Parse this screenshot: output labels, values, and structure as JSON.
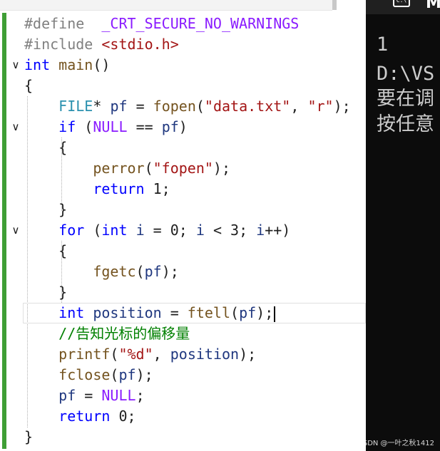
{
  "editor": {
    "lines": [
      {
        "fold": "",
        "tokens": [
          {
            "t": "#define  ",
            "c": "pp"
          },
          {
            "t": "_CRT_SECURE_NO_WARNINGS",
            "c": "mac"
          }
        ]
      },
      {
        "fold": "",
        "tokens": [
          {
            "t": "#include ",
            "c": "pp"
          },
          {
            "t": "<stdio.h>",
            "c": "str"
          }
        ]
      },
      {
        "fold": "∨",
        "tokens": [
          {
            "t": "int",
            "c": "kw"
          },
          {
            "t": " ",
            "c": "plain"
          },
          {
            "t": "main",
            "c": "fn"
          },
          {
            "t": "()",
            "c": "plain"
          }
        ]
      },
      {
        "fold": "",
        "tokens": [
          {
            "t": "{",
            "c": "plain"
          }
        ]
      },
      {
        "fold": "",
        "tokens": [
          {
            "t": "    ",
            "c": "plain"
          },
          {
            "t": "FILE",
            "c": "ty"
          },
          {
            "t": "* ",
            "c": "plain"
          },
          {
            "t": "pf",
            "c": "var"
          },
          {
            "t": " = ",
            "c": "plain"
          },
          {
            "t": "fopen",
            "c": "fn"
          },
          {
            "t": "(",
            "c": "plain"
          },
          {
            "t": "\"data.txt\"",
            "c": "str"
          },
          {
            "t": ", ",
            "c": "plain"
          },
          {
            "t": "\"r\"",
            "c": "str"
          },
          {
            "t": ");",
            "c": "plain"
          }
        ]
      },
      {
        "fold": "∨",
        "tokens": [
          {
            "t": "    ",
            "c": "plain"
          },
          {
            "t": "if",
            "c": "kw"
          },
          {
            "t": " (",
            "c": "plain"
          },
          {
            "t": "NULL",
            "c": "mac"
          },
          {
            "t": " == ",
            "c": "plain"
          },
          {
            "t": "pf",
            "c": "var"
          },
          {
            "t": ")",
            "c": "plain"
          }
        ]
      },
      {
        "fold": "",
        "tokens": [
          {
            "t": "    {",
            "c": "plain"
          }
        ]
      },
      {
        "fold": "",
        "tokens": [
          {
            "t": "        ",
            "c": "plain"
          },
          {
            "t": "perror",
            "c": "fn"
          },
          {
            "t": "(",
            "c": "plain"
          },
          {
            "t": "\"fopen\"",
            "c": "str"
          },
          {
            "t": ");",
            "c": "plain"
          }
        ]
      },
      {
        "fold": "",
        "tokens": [
          {
            "t": "        ",
            "c": "plain"
          },
          {
            "t": "return",
            "c": "kw"
          },
          {
            "t": " 1;",
            "c": "plain"
          }
        ]
      },
      {
        "fold": "",
        "tokens": [
          {
            "t": "    }",
            "c": "plain"
          }
        ]
      },
      {
        "fold": "∨",
        "tokens": [
          {
            "t": "    ",
            "c": "plain"
          },
          {
            "t": "for",
            "c": "kw"
          },
          {
            "t": " (",
            "c": "plain"
          },
          {
            "t": "int",
            "c": "kw"
          },
          {
            "t": " ",
            "c": "plain"
          },
          {
            "t": "i",
            "c": "var"
          },
          {
            "t": " = 0; ",
            "c": "plain"
          },
          {
            "t": "i",
            "c": "var"
          },
          {
            "t": " < 3; ",
            "c": "plain"
          },
          {
            "t": "i",
            "c": "var"
          },
          {
            "t": "++)",
            "c": "plain"
          }
        ]
      },
      {
        "fold": "",
        "tokens": [
          {
            "t": "    {",
            "c": "plain"
          }
        ]
      },
      {
        "fold": "",
        "tokens": [
          {
            "t": "        ",
            "c": "plain"
          },
          {
            "t": "fgetc",
            "c": "fn"
          },
          {
            "t": "(",
            "c": "plain"
          },
          {
            "t": "pf",
            "c": "var"
          },
          {
            "t": ");",
            "c": "plain"
          }
        ]
      },
      {
        "fold": "",
        "tokens": [
          {
            "t": "    }",
            "c": "plain"
          }
        ]
      },
      {
        "fold": "",
        "current": true,
        "tokens": [
          {
            "t": "    ",
            "c": "plain"
          },
          {
            "t": "int",
            "c": "kw"
          },
          {
            "t": " ",
            "c": "plain"
          },
          {
            "t": "position",
            "c": "var"
          },
          {
            "t": " = ",
            "c": "plain"
          },
          {
            "t": "ftell",
            "c": "fn"
          },
          {
            "t": "(",
            "c": "plain"
          },
          {
            "t": "pf",
            "c": "var"
          },
          {
            "t": ");",
            "c": "plain"
          }
        ]
      },
      {
        "fold": "",
        "tokens": [
          {
            "t": "    ",
            "c": "plain"
          },
          {
            "t": "//告知光标的偏移量",
            "c": "cmt"
          }
        ]
      },
      {
        "fold": "",
        "tokens": [
          {
            "t": "    ",
            "c": "plain"
          },
          {
            "t": "printf",
            "c": "fn"
          },
          {
            "t": "(",
            "c": "plain"
          },
          {
            "t": "\"%d\"",
            "c": "str"
          },
          {
            "t": ", ",
            "c": "plain"
          },
          {
            "t": "position",
            "c": "var"
          },
          {
            "t": ");",
            "c": "plain"
          }
        ]
      },
      {
        "fold": "",
        "tokens": [
          {
            "t": "    ",
            "c": "plain"
          },
          {
            "t": "fclose",
            "c": "fn"
          },
          {
            "t": "(",
            "c": "plain"
          },
          {
            "t": "pf",
            "c": "var"
          },
          {
            "t": ");",
            "c": "plain"
          }
        ]
      },
      {
        "fold": "",
        "tokens": [
          {
            "t": "    ",
            "c": "plain"
          },
          {
            "t": "pf",
            "c": "var"
          },
          {
            "t": " = ",
            "c": "plain"
          },
          {
            "t": "NULL",
            "c": "mac"
          },
          {
            "t": ";",
            "c": "plain"
          }
        ]
      },
      {
        "fold": "",
        "tokens": [
          {
            "t": "    ",
            "c": "plain"
          },
          {
            "t": "return",
            "c": "kw"
          },
          {
            "t": " 0;",
            "c": "plain"
          }
        ]
      },
      {
        "fold": "",
        "tokens": [
          {
            "t": "}",
            "c": "plain"
          }
        ]
      }
    ],
    "colors": {
      "change_bar": "#3f9e35",
      "keyword": "#0000ff",
      "string": "#a31515",
      "comment": "#008000",
      "type": "#2b91af",
      "macro": "#8a1bff"
    }
  },
  "console": {
    "title": "M",
    "icon": "terminal-icon",
    "lines": [
      "1",
      "D:\\VS",
      "要在调",
      "按任意"
    ]
  },
  "watermark": "CSDN @一叶之秋1412"
}
